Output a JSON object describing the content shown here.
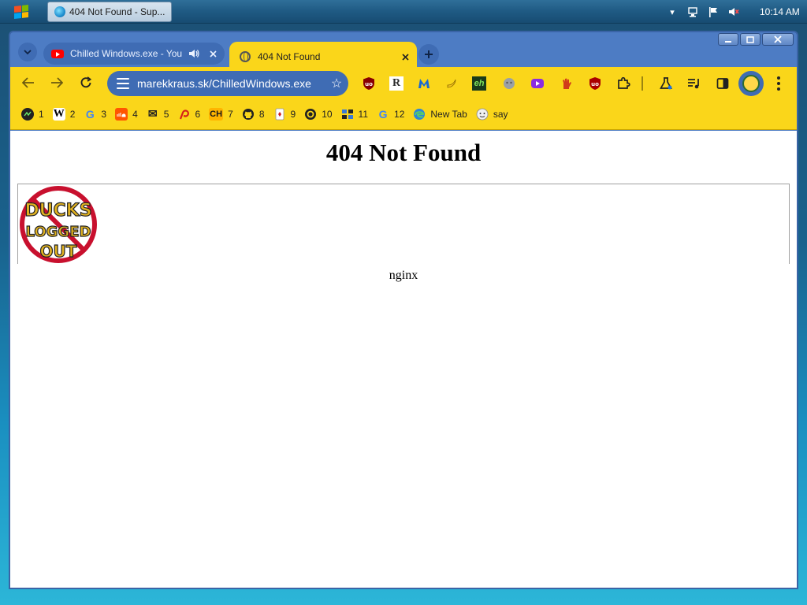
{
  "taskbar": {
    "task_title": "404 Not Found - Sup...",
    "clock": "10:14 AM"
  },
  "browser": {
    "tabs": [
      {
        "title": "Chilled Windows.exe - You",
        "favicon": "youtube-icon",
        "audio": true
      },
      {
        "title": "404 Not Found",
        "favicon": "globe-icon",
        "active": true
      }
    ],
    "url": "marekkraus.sk/ChilledWindows.exe",
    "bookmarks": [
      {
        "label": "1",
        "icon": "bookmark-1-icon"
      },
      {
        "label": "2",
        "icon": "wikipedia-icon",
        "glyph": "W"
      },
      {
        "label": "3",
        "icon": "google-icon",
        "glyph": "G"
      },
      {
        "label": "4",
        "icon": "soundcloud-icon"
      },
      {
        "label": "5",
        "icon": "mail-icon",
        "glyph": "✉"
      },
      {
        "label": "6",
        "icon": "pinterest-like-icon"
      },
      {
        "label": "7",
        "icon": "ch-icon",
        "glyph": "CH"
      },
      {
        "label": "8",
        "icon": "github-icon"
      },
      {
        "label": "9",
        "icon": "cards-icon"
      },
      {
        "label": "10",
        "icon": "circle-logo-icon"
      },
      {
        "label": "11",
        "icon": "app-grid-icon"
      },
      {
        "label": "12",
        "icon": "google-icon",
        "glyph": "G"
      },
      {
        "label": "New Tab",
        "icon": "edge-icon"
      },
      {
        "label": "say",
        "icon": "face-icon"
      }
    ],
    "extension_glyphs": [
      "R",
      "eh"
    ]
  },
  "page": {
    "heading": "404 Not Found",
    "image_text_top": "DUCKS",
    "image_text_mid": "LOGGED",
    "image_text_bot": "OUT",
    "server": "nginx"
  },
  "colors": {
    "chrome_yellow": "#fad61a",
    "chrome_blue": "#3f6cb4"
  }
}
